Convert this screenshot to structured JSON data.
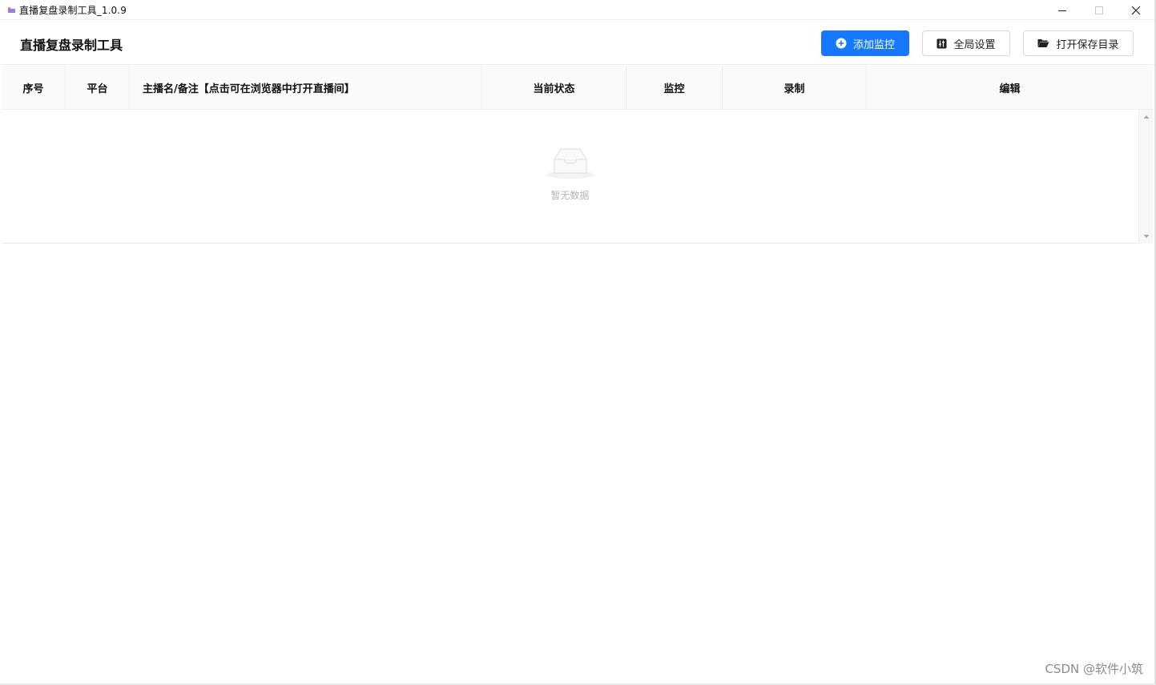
{
  "window": {
    "title": "直播复盘录制工具_1.0.9",
    "controls": [
      "minimize-icon",
      "maximize-icon",
      "close-icon"
    ]
  },
  "header": {
    "title": "直播复盘录制工具",
    "buttons": {
      "add_monitor": {
        "label": "添加监控",
        "icon": "plus-circle-icon"
      },
      "global_settings": {
        "label": "全局设置",
        "icon": "sliders-icon"
      },
      "open_folder": {
        "label": "打开保存目录",
        "icon": "folder-open-icon"
      }
    }
  },
  "table": {
    "columns": [
      "序号",
      "平台",
      "主播名/备注【点击可在浏览器中打开直播间】",
      "当前状态",
      "监控",
      "录制",
      "编辑"
    ],
    "rows": [],
    "empty_text": "暂无数据"
  },
  "watermark": "CSDN @软件小筑",
  "colors": {
    "primary": "#1677ff",
    "border": "#d9d9d9",
    "header_bg": "#fafafa",
    "empty_text": "#b5b5b5"
  }
}
